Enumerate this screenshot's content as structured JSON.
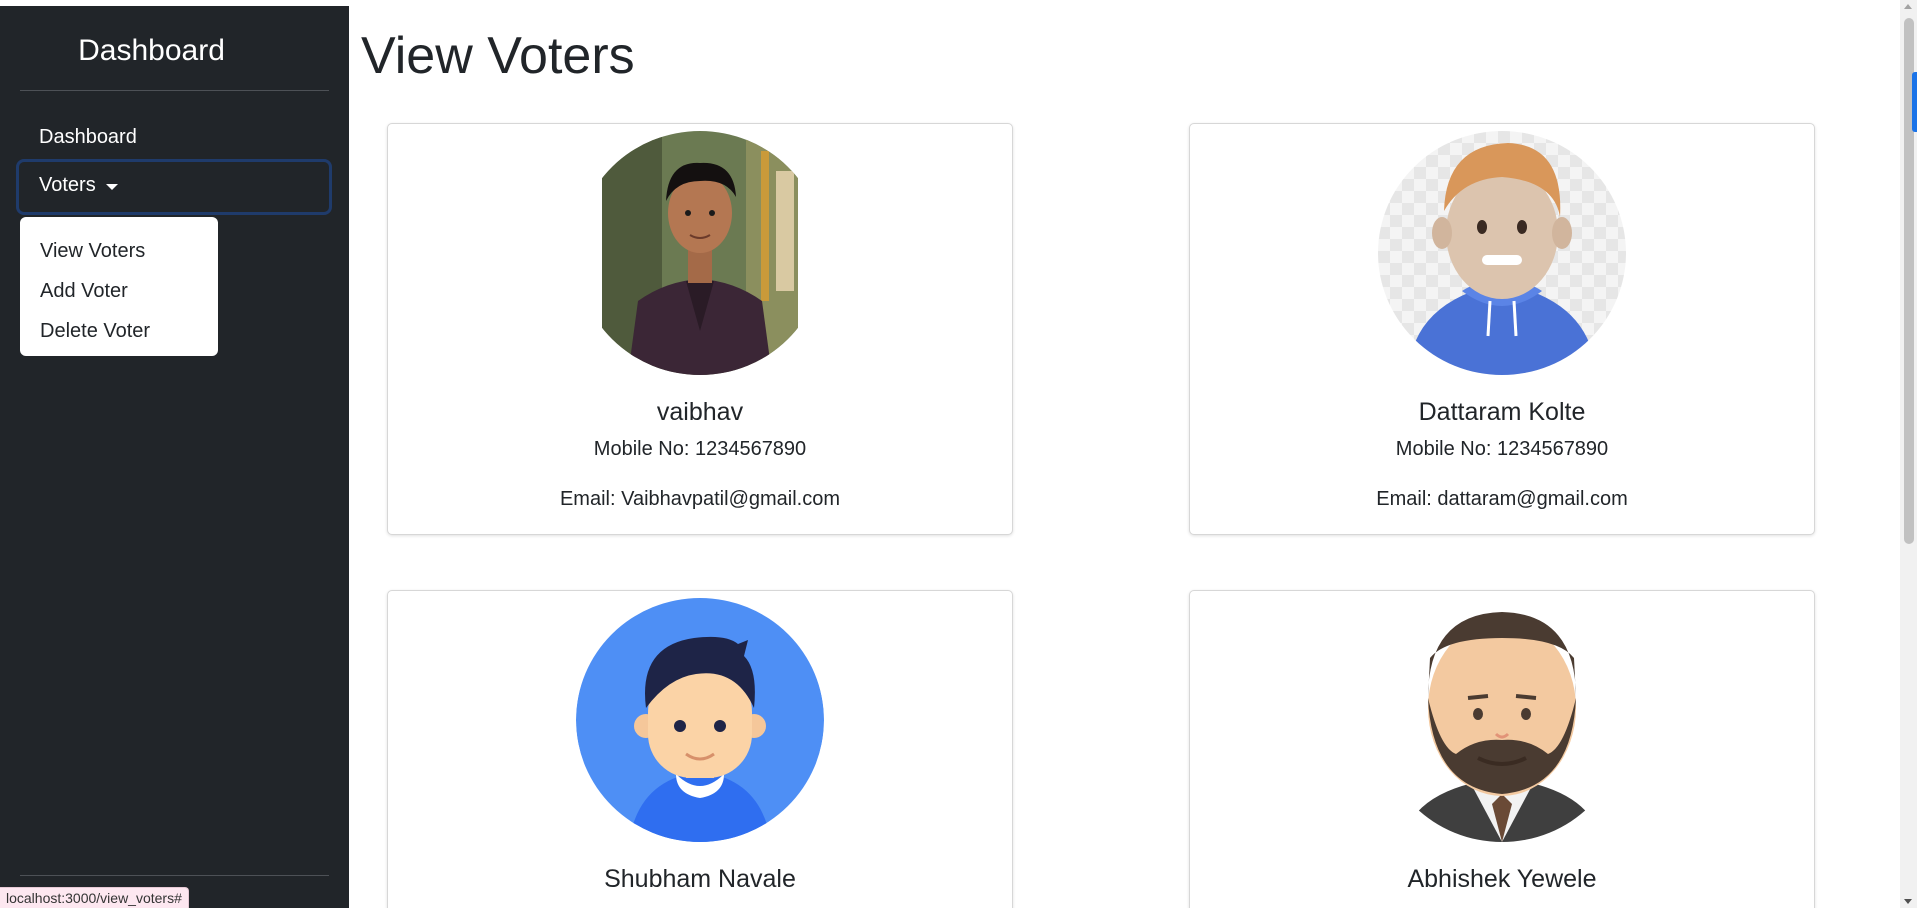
{
  "sidebar": {
    "brand": "Dashboard",
    "nav": {
      "dashboard": "Dashboard",
      "voters": "Voters"
    },
    "dropdown": [
      "View Voters",
      "Add Voter",
      "Delete Voter"
    ]
  },
  "page": {
    "title": "View Voters"
  },
  "voters": [
    {
      "name": "vaibhav",
      "mobile": "Mobile No: 1234567890",
      "email": "Email: Vaibhavpatil@gmail.com",
      "avatar": "photo-avatar-icon"
    },
    {
      "name": "Dattaram Kolte",
      "mobile": "Mobile No: 1234567890",
      "email": "Email: dattaram@gmail.com",
      "avatar": "3d-avatar-icon"
    },
    {
      "name": "Shubham Navale",
      "avatar": "boy-avatar-icon"
    },
    {
      "name": "Abhishek Yewele",
      "avatar": "bearded-man-avatar-icon"
    }
  ],
  "status_bar": {
    "url": "localhost:3000/view_voters#"
  },
  "colors": {
    "sidebar_bg": "#212529",
    "accent": "#1a73e8",
    "avatar_blue": "#4e8ff5"
  }
}
